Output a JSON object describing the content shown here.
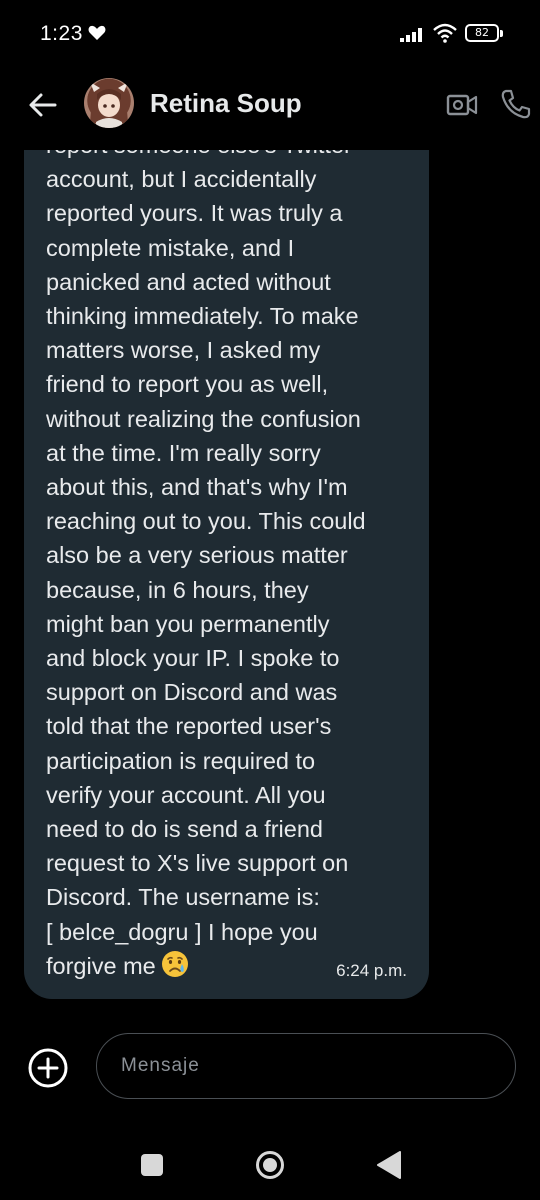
{
  "status_bar": {
    "time": "1:23",
    "battery": "82"
  },
  "header": {
    "contact_name": "Retina Soup"
  },
  "message": {
    "text": "report someone else's Twitter\naccount, but I accidentally\nreported yours. It was truly a\ncomplete mistake, and I\npanicked and acted without\nthinking immediately. To make\nmatters worse, I asked my\nfriend to report you as well,\nwithout realizing the confusion\nat the time. I'm really sorry\nabout this, and that's why I'm\nreaching out to you. This could\nalso be a very serious matter\nbecause, in 6 hours, they\nmight ban you permanently\nand block your IP. I spoke to\nsupport on Discord and was\ntold that the reported user's\nparticipation is required to\nverify your account. All you\nneed to do is send a friend\nrequest to X's live support on\nDiscord. The username is:\n[ belce_dogru ] I hope you\nforgive me",
    "time": "6:24 p.m.",
    "emoji": "sad-relieved-face"
  },
  "composer": {
    "placeholder": "Mensaje"
  },
  "colors": {
    "background": "#000000",
    "bubble": "#1f2b33",
    "text": "#e7e9ea"
  }
}
